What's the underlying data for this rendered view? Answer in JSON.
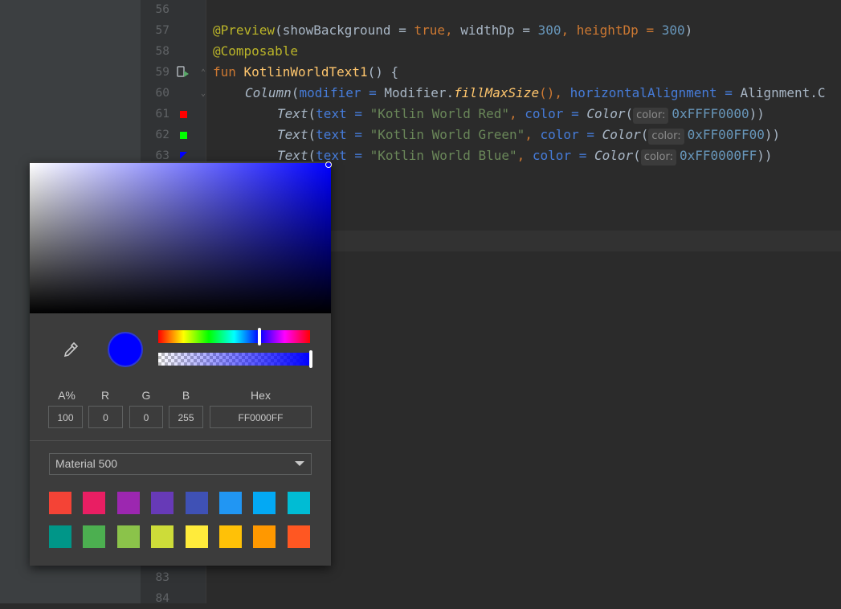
{
  "editor": {
    "line_numbers": [
      "56",
      "57",
      "58",
      "59",
      "60",
      "61",
      "62",
      "63",
      "83",
      "84"
    ],
    "lines": {
      "l57": {
        "ann": "@Preview",
        "p1": "(showBackground = ",
        "true": "true",
        ",": ", ",
        "wd": "widthDp = ",
        "n300a": "300",
        "c2": ", heightDp = ",
        "n300b": "300",
        "close": ")"
      },
      "l58": {
        "ann": "@Composable"
      },
      "l59": {
        "kw": "fun ",
        "name": "KotlinWorldText1",
        "rest": "() {"
      },
      "l60": {
        "col": "Column",
        "p1": "(",
        "mod": "modifier",
        "eq": " = ",
        "modv": "Modifier.",
        "fms": "fillMaxSize",
        "p2": "(), ",
        "ha": "horizontalAlignment",
        "eq2": " = ",
        "al": "Alignment.C"
      },
      "l61": {
        "text": "Text",
        "p1": "(",
        "tparam": "text",
        "eq": " = ",
        "str": "\"Kotlin World Red\"",
        "c": ", ",
        "cparam": "color",
        "eq2": " = ",
        "col": "Color",
        "p2": "(",
        "hint": "color:",
        "val": "0xFFFF0000",
        "close": "))"
      },
      "l62": {
        "text": "Text",
        "p1": "(",
        "tparam": "text",
        "eq": " = ",
        "str": "\"Kotlin World Green\"",
        "c": ", ",
        "cparam": "color",
        "eq2": " = ",
        "col": "Color",
        "p2": "(",
        "hint": "color:",
        "val": "0xFF00FF00",
        "close": "))"
      },
      "l63": {
        "text": "Text",
        "p1": "(",
        "tparam": "text",
        "eq": " = ",
        "str": "\"Kotlin World Blue\"",
        "c": ", ",
        "cparam": "color",
        "eq2": " = ",
        "col": "Color",
        "p2": "(",
        "hint": "color:",
        "val": "0xFF0000FF",
        "close": "))"
      }
    },
    "gutter_swatch_colors": [
      "#ff0000",
      "#00ff00",
      "#0000ff"
    ]
  },
  "picker": {
    "selected_color": "#0000ff",
    "fields": [
      {
        "label": "A%",
        "value": "100"
      },
      {
        "label": "R",
        "value": "0"
      },
      {
        "label": "G",
        "value": "0"
      },
      {
        "label": "B",
        "value": "255"
      },
      {
        "label": "Hex",
        "value": "FF0000FF"
      }
    ],
    "palette_name": "Material 500",
    "palette_colors": [
      "#f44336",
      "#e91e63",
      "#9c27b0",
      "#673ab7",
      "#3f51b5",
      "#2196f3",
      "#03a9f4",
      "#00bcd4",
      "#009688",
      "#4caf50",
      "#8bc34a",
      "#cddc39",
      "#ffeb3b",
      "#ffc107",
      "#ff9800",
      "#ff5722"
    ],
    "icons": {
      "eyedropper": "eyedropper-icon",
      "dropdown": "chevron-down-icon"
    }
  }
}
